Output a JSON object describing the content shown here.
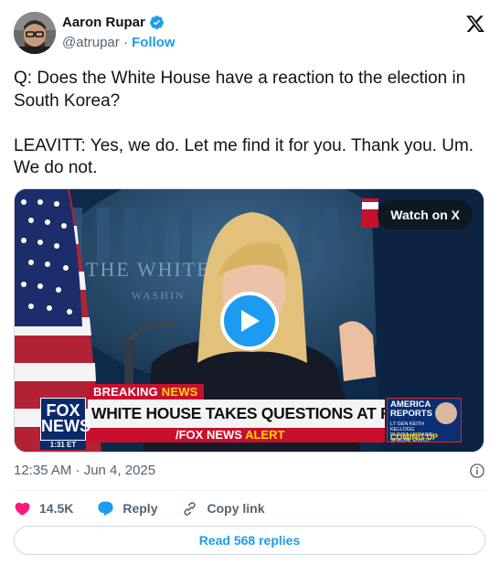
{
  "author": {
    "display_name": "Aaron Rupar",
    "handle": "@atrupar",
    "separator": "·",
    "follow_label": "Follow",
    "verified_icon": "verified-badge-icon",
    "accent_color": "#1d9bf0"
  },
  "platform_logo": "x-logo-icon",
  "tweet": {
    "text": "Q: Does the White House have a reaction to the election in South Korea?\n\nLEAVITT: Yes, we do. Let me find it for you. Thank you. Um. We do not."
  },
  "media": {
    "watch_label": "Watch on X",
    "play_icon": "play-icon",
    "broadcast": {
      "wall_text_1": "THE WHITE",
      "wall_text_2": "WASHIN",
      "breaking_word": "BREAKING",
      "news_word": "NEWS",
      "headline": "WHITE HOUSE TAKES QUESTIONS AT PRESS BRIEFING",
      "alert_prefix": "/FOX NEWS",
      "alert_word": "ALERT",
      "network_line_1": "FOX",
      "network_line_2": "NEWS",
      "clock": "1:31 ET",
      "show_line_1": "AMERICA",
      "show_line_2": "REPORTS",
      "guest_caption": "LT GEN KEITH KELLOGG RUSSIA-UKRAINE SPECIAL ENVOY",
      "show_footer": "COMING UP"
    }
  },
  "timestamp": "12:35 AM · Jun 4, 2025",
  "info_icon": "info-icon",
  "actions": {
    "like_count": "14.5K",
    "reply_label": "Reply",
    "copy_link_label": "Copy link",
    "like_color": "#f91880"
  },
  "read_replies_label": "Read 568 replies"
}
